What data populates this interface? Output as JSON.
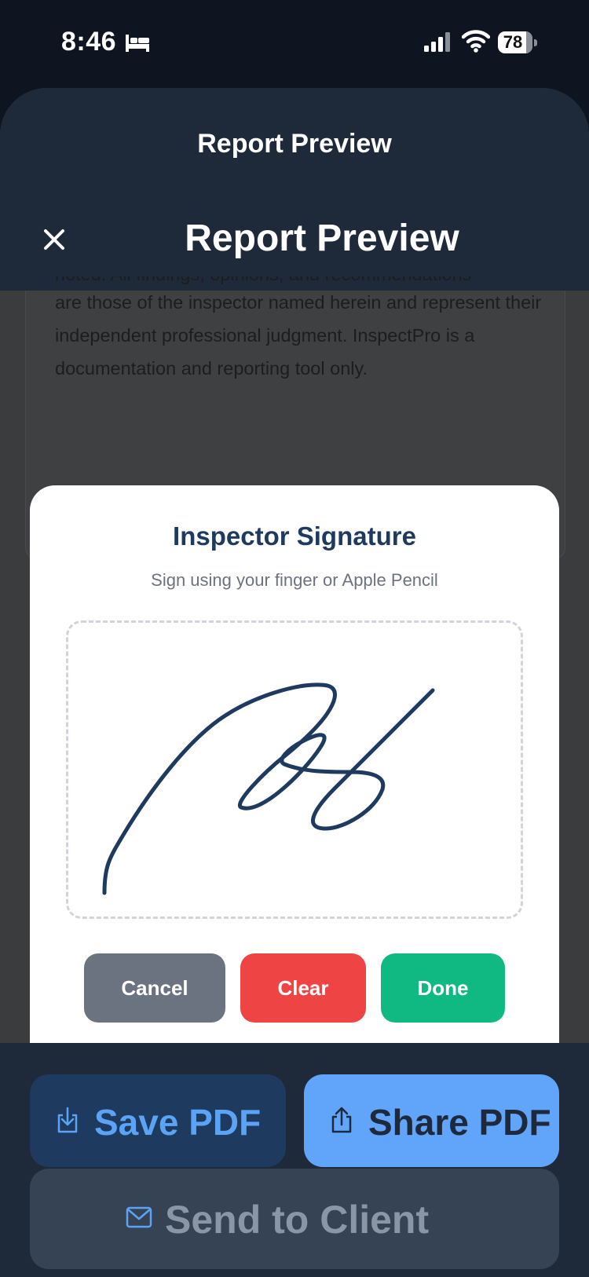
{
  "status_bar": {
    "time": "8:46",
    "battery": "78"
  },
  "sheet": {
    "title": "Report Preview",
    "nav_title": "Report Preview"
  },
  "report": {
    "text_cut": "noted. All findings, opinions, and recommendations",
    "text": "are those of the inspector named herein and represent their independent professional judgment. InspectPro is a documentation and reporting tool only."
  },
  "signature_modal": {
    "title": "Inspector Signature",
    "subtitle": "Sign using your finger or Apple Pencil",
    "cancel_label": "Cancel",
    "clear_label": "Clear",
    "done_label": "Done",
    "stroke_color": "#1e3a5f"
  },
  "actions": {
    "save_pdf": "Save PDF",
    "share_pdf": "Share PDF",
    "send_to_client": "Send to Client"
  },
  "colors": {
    "header_bg": "#1e2a3a",
    "accent_blue": "#60a5fa",
    "cancel_gray": "#6b7280",
    "clear_red": "#ef4444",
    "done_green": "#10b981"
  }
}
